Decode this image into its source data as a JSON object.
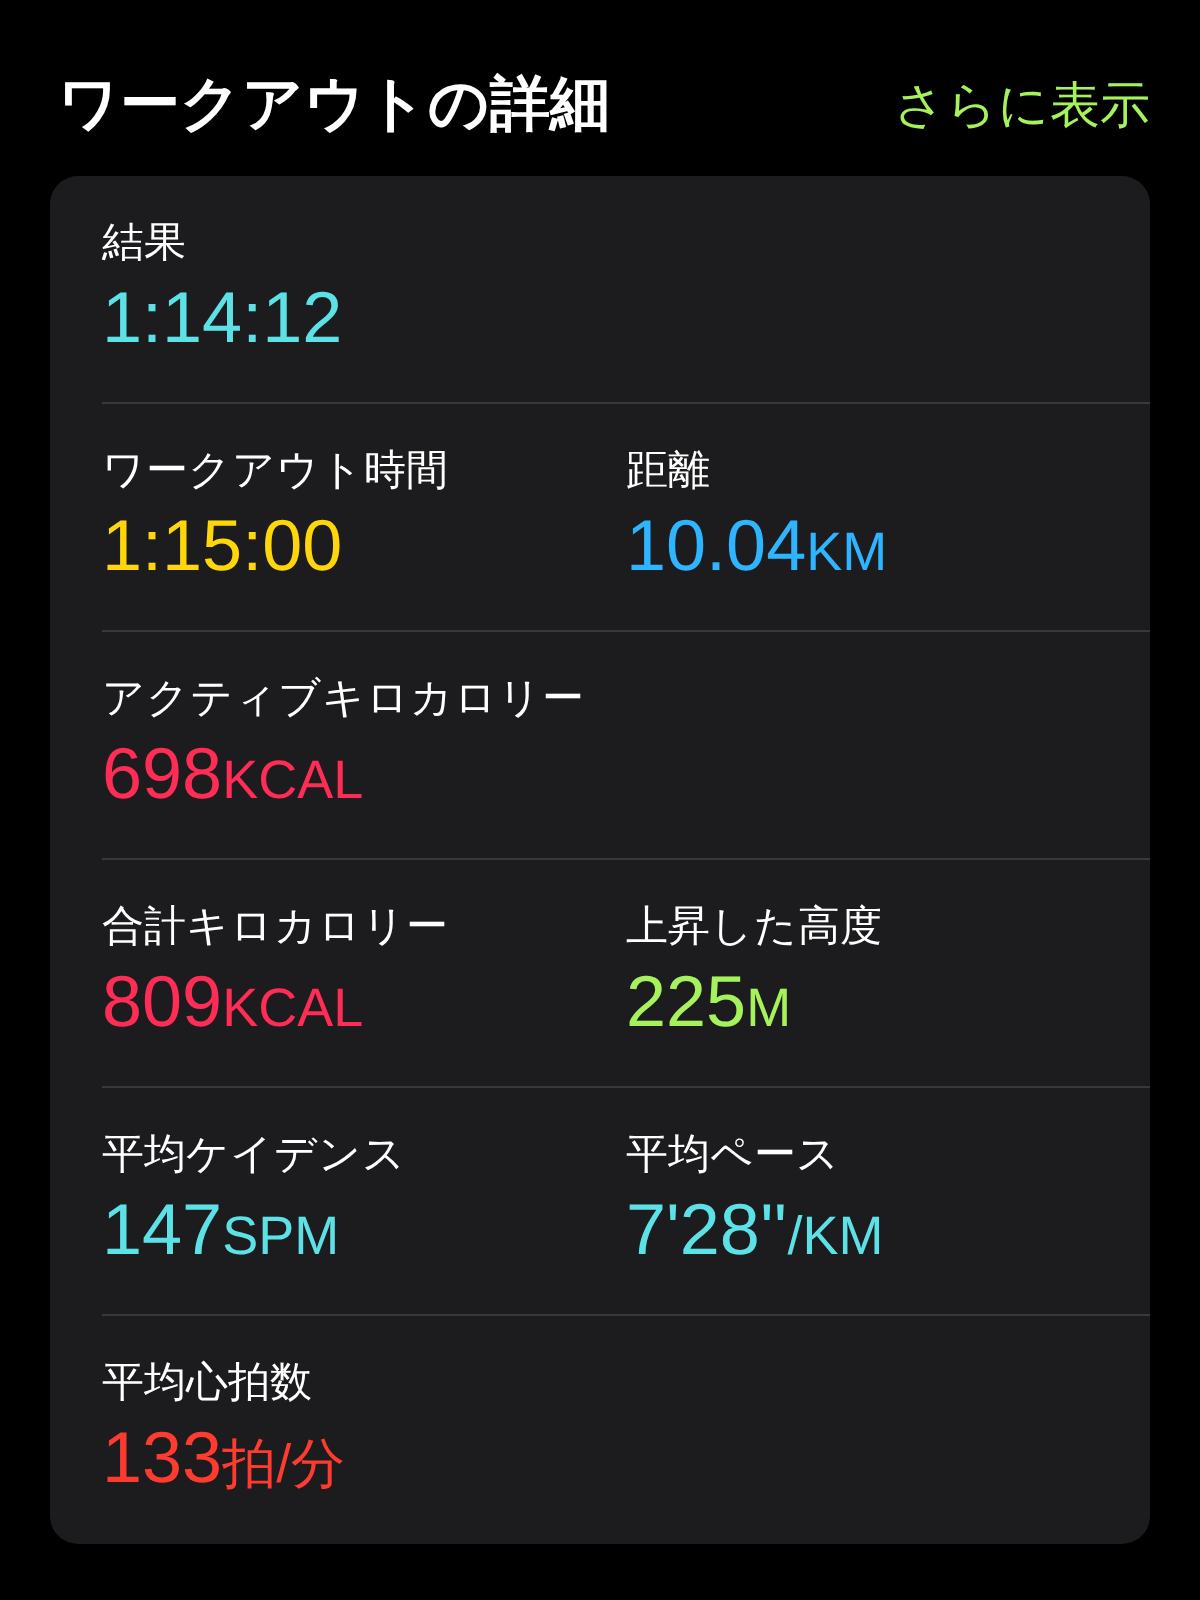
{
  "header": {
    "title": "ワークアウトの詳細",
    "link": "さらに表示"
  },
  "rows": [
    {
      "metrics": [
        {
          "label": "結果",
          "value": "1:14:12",
          "color": "#5ce1e6"
        }
      ]
    },
    {
      "metrics": [
        {
          "label": "ワークアウト時間",
          "value": "1:15:00",
          "color": "#ffd60a"
        },
        {
          "label": "距離",
          "value": "10.04",
          "unit": "KM",
          "color": "#2fb4ff"
        }
      ]
    },
    {
      "metrics": [
        {
          "label": "アクティブキロカロリー",
          "value": "698",
          "unit": "KCAL",
          "color": "#ff2d55"
        }
      ]
    },
    {
      "metrics": [
        {
          "label": "合計キロカロリー",
          "value": "809",
          "unit": "KCAL",
          "color": "#ff2d55"
        },
        {
          "label": "上昇した高度",
          "value": "225",
          "unit": "M",
          "color": "#a6f25c"
        }
      ]
    },
    {
      "metrics": [
        {
          "label": "平均ケイデンス",
          "value": "147",
          "unit": "SPM",
          "color": "#5ce1e6"
        },
        {
          "label": "平均ペース",
          "value": "7'28''",
          "unit": "/KM",
          "color": "#5ce1e6"
        }
      ]
    },
    {
      "metrics": [
        {
          "label": "平均心拍数",
          "value": "133",
          "unit": "拍/分",
          "color": "#ff3b30"
        }
      ]
    }
  ]
}
